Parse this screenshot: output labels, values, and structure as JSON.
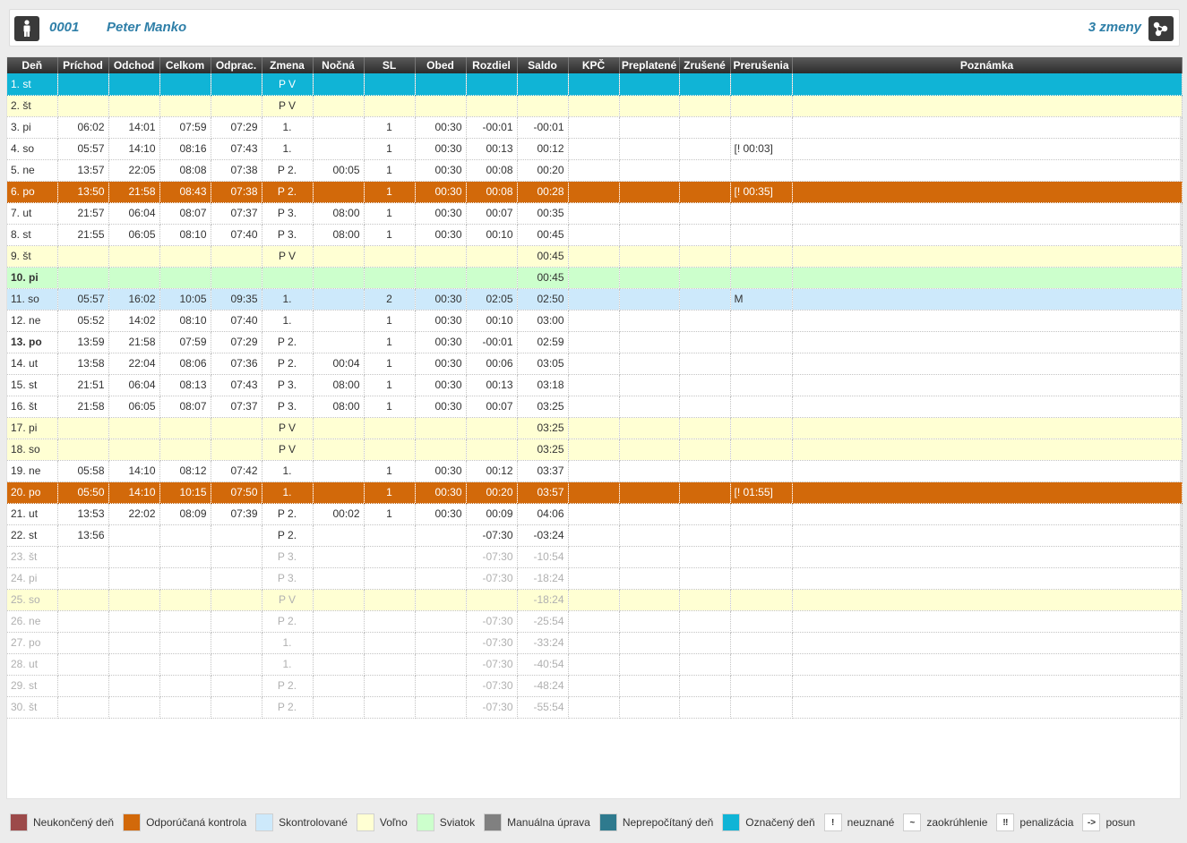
{
  "header": {
    "employee_id": "0001",
    "employee_name": "Peter Manko",
    "shifts_label": "3 zmeny",
    "person_icon": "person-icon",
    "shift_icon": "share-icon"
  },
  "columns": [
    "Deň",
    "Príchod",
    "Odchod",
    "Celkom",
    "Odprac.",
    "Zmena",
    "Nočná",
    "SL",
    "Obed",
    "Rozdiel",
    "Saldo",
    "KPČ",
    "Preplatené",
    "Zrušené",
    "Prerušenia",
    "Poznámka"
  ],
  "rows": [
    {
      "t": "oznaceny",
      "bold": false,
      "c": [
        "1. st",
        "",
        "",
        "",
        "",
        "P V",
        "",
        "",
        "",
        "",
        "",
        "",
        "",
        "",
        "",
        ""
      ]
    },
    {
      "t": "volno",
      "bold": false,
      "c": [
        "2. št",
        "",
        "",
        "",
        "",
        "P V",
        "",
        "",
        "",
        "",
        "",
        "",
        "",
        "",
        "",
        ""
      ]
    },
    {
      "t": "",
      "bold": false,
      "c": [
        "3. pi",
        "06:02",
        "14:01",
        "07:59",
        "07:29",
        "1.",
        "",
        "1",
        "00:30",
        "-00:01",
        "-00:01",
        "",
        "",
        "",
        "",
        ""
      ]
    },
    {
      "t": "",
      "bold": false,
      "c": [
        "4. so",
        "05:57",
        "14:10",
        "08:16",
        "07:43",
        "1.",
        "",
        "1",
        "00:30",
        "00:13",
        "00:12",
        "",
        "",
        "",
        "[! 00:03]",
        ""
      ]
    },
    {
      "t": "",
      "bold": false,
      "c": [
        "5. ne",
        "13:57",
        "22:05",
        "08:08",
        "07:38",
        "P 2.",
        "00:05",
        "1",
        "00:30",
        "00:08",
        "00:20",
        "",
        "",
        "",
        "",
        ""
      ]
    },
    {
      "t": "kontrola",
      "bold": false,
      "c": [
        "6. po",
        "13:50",
        "21:58",
        "08:43",
        "07:38",
        "P 2.",
        "",
        "1",
        "00:30",
        "00:08",
        "00:28",
        "",
        "",
        "",
        "[! 00:35]",
        ""
      ]
    },
    {
      "t": "",
      "bold": false,
      "c": [
        "7. ut",
        "21:57",
        "06:04",
        "08:07",
        "07:37",
        "P 3.",
        "08:00",
        "1",
        "00:30",
        "00:07",
        "00:35",
        "",
        "",
        "",
        "",
        ""
      ]
    },
    {
      "t": "",
      "bold": false,
      "c": [
        "8. st",
        "21:55",
        "06:05",
        "08:10",
        "07:40",
        "P 3.",
        "08:00",
        "1",
        "00:30",
        "00:10",
        "00:45",
        "",
        "",
        "",
        "",
        ""
      ]
    },
    {
      "t": "volno",
      "bold": false,
      "c": [
        "9. št",
        "",
        "",
        "",
        "",
        "P V",
        "",
        "",
        "",
        "",
        "00:45",
        "",
        "",
        "",
        "",
        ""
      ]
    },
    {
      "t": "sviatok",
      "bold": true,
      "c": [
        "10. pi",
        "",
        "",
        "",
        "",
        "",
        "",
        "",
        "",
        "",
        "00:45",
        "",
        "",
        "",
        "",
        ""
      ]
    },
    {
      "t": "skontrolovane",
      "bold": false,
      "c": [
        "11. so",
        "05:57",
        "16:02",
        "10:05",
        "09:35",
        "1.",
        "",
        "2",
        "00:30",
        "02:05",
        "02:50",
        "",
        "",
        "",
        "M",
        ""
      ]
    },
    {
      "t": "",
      "bold": false,
      "c": [
        "12. ne",
        "05:52",
        "14:02",
        "08:10",
        "07:40",
        "1.",
        "",
        "1",
        "00:30",
        "00:10",
        "03:00",
        "",
        "",
        "",
        "",
        ""
      ]
    },
    {
      "t": "",
      "bold": true,
      "c": [
        "13. po",
        "13:59",
        "21:58",
        "07:59",
        "07:29",
        "P 2.",
        "",
        "1",
        "00:30",
        "-00:01",
        "02:59",
        "",
        "",
        "",
        "",
        ""
      ]
    },
    {
      "t": "",
      "bold": false,
      "c": [
        "14. ut",
        "13:58",
        "22:04",
        "08:06",
        "07:36",
        "P 2.",
        "00:04",
        "1",
        "00:30",
        "00:06",
        "03:05",
        "",
        "",
        "",
        "",
        ""
      ]
    },
    {
      "t": "",
      "bold": false,
      "c": [
        "15. st",
        "21:51",
        "06:04",
        "08:13",
        "07:43",
        "P 3.",
        "08:00",
        "1",
        "00:30",
        "00:13",
        "03:18",
        "",
        "",
        "",
        "",
        ""
      ]
    },
    {
      "t": "",
      "bold": false,
      "c": [
        "16. št",
        "21:58",
        "06:05",
        "08:07",
        "07:37",
        "P 3.",
        "08:00",
        "1",
        "00:30",
        "00:07",
        "03:25",
        "",
        "",
        "",
        "",
        ""
      ]
    },
    {
      "t": "volno",
      "bold": false,
      "c": [
        "17. pi",
        "",
        "",
        "",
        "",
        "P V",
        "",
        "",
        "",
        "",
        "03:25",
        "",
        "",
        "",
        "",
        ""
      ]
    },
    {
      "t": "volno",
      "bold": false,
      "c": [
        "18. so",
        "",
        "",
        "",
        "",
        "P V",
        "",
        "",
        "",
        "",
        "03:25",
        "",
        "",
        "",
        "",
        ""
      ]
    },
    {
      "t": "",
      "bold": false,
      "c": [
        "19. ne",
        "05:58",
        "14:10",
        "08:12",
        "07:42",
        "1.",
        "",
        "1",
        "00:30",
        "00:12",
        "03:37",
        "",
        "",
        "",
        "",
        ""
      ]
    },
    {
      "t": "kontrola",
      "bold": false,
      "c": [
        "20. po",
        "05:50",
        "14:10",
        "10:15",
        "07:50",
        "1.",
        "",
        "1",
        "00:30",
        "00:20",
        "03:57",
        "",
        "",
        "",
        "[! 01:55]",
        ""
      ]
    },
    {
      "t": "",
      "bold": false,
      "c": [
        "21. ut",
        "13:53",
        "22:02",
        "08:09",
        "07:39",
        "P 2.",
        "00:02",
        "1",
        "00:30",
        "00:09",
        "04:06",
        "",
        "",
        "",
        "",
        ""
      ]
    },
    {
      "t": "",
      "bold": false,
      "c": [
        "22. st",
        "13:56",
        "",
        "",
        "",
        "P 2.",
        "",
        "",
        "",
        "-07:30",
        "-03:24",
        "",
        "",
        "",
        "",
        ""
      ]
    },
    {
      "t": "future",
      "bold": false,
      "c": [
        "23. št",
        "",
        "",
        "",
        "",
        "P 3.",
        "",
        "",
        "",
        "-07:30",
        "-10:54",
        "",
        "",
        "",
        "",
        ""
      ]
    },
    {
      "t": "future",
      "bold": false,
      "c": [
        "24. pi",
        "",
        "",
        "",
        "",
        "P 3.",
        "",
        "",
        "",
        "-07:30",
        "-18:24",
        "",
        "",
        "",
        "",
        ""
      ]
    },
    {
      "t": "volno future",
      "bold": false,
      "c": [
        "25. so",
        "",
        "",
        "",
        "",
        "P V",
        "",
        "",
        "",
        "",
        "-18:24",
        "",
        "",
        "",
        "",
        ""
      ]
    },
    {
      "t": "future",
      "bold": false,
      "c": [
        "26. ne",
        "",
        "",
        "",
        "",
        "P 2.",
        "",
        "",
        "",
        "-07:30",
        "-25:54",
        "",
        "",
        "",
        "",
        ""
      ]
    },
    {
      "t": "future",
      "bold": false,
      "c": [
        "27. po",
        "",
        "",
        "",
        "",
        "1.",
        "",
        "",
        "",
        "-07:30",
        "-33:24",
        "",
        "",
        "",
        "",
        ""
      ]
    },
    {
      "t": "future",
      "bold": false,
      "c": [
        "28. ut",
        "",
        "",
        "",
        "",
        "1.",
        "",
        "",
        "",
        "-07:30",
        "-40:54",
        "",
        "",
        "",
        "",
        ""
      ]
    },
    {
      "t": "future",
      "bold": false,
      "c": [
        "29. st",
        "",
        "",
        "",
        "",
        "P 2.",
        "",
        "",
        "",
        "-07:30",
        "-48:24",
        "",
        "",
        "",
        "",
        ""
      ]
    },
    {
      "t": "future",
      "bold": false,
      "c": [
        "30. št",
        "",
        "",
        "",
        "",
        "P 2.",
        "",
        "",
        "",
        "-07:30",
        "-55:54",
        "",
        "",
        "",
        "",
        ""
      ]
    }
  ],
  "legend": [
    {
      "type": "swatch",
      "color": "#9c4a4a",
      "label": "Neukončený deň"
    },
    {
      "type": "swatch",
      "color": "#d2690a",
      "label": "Odporúčaná kontrola"
    },
    {
      "type": "swatch",
      "color": "#cde9fb",
      "label": "Skontrolované"
    },
    {
      "type": "swatch",
      "color": "#ffffd3",
      "label": "Voľno"
    },
    {
      "type": "swatch",
      "color": "#ccffcc",
      "label": "Sviatok"
    },
    {
      "type": "swatch",
      "color": "#808080",
      "label": "Manuálna úprava"
    },
    {
      "type": "swatch",
      "color": "#2e7a8e",
      "label": "Neprepočítaný deň"
    },
    {
      "type": "swatch",
      "color": "#10b4d6",
      "label": "Označený deň"
    },
    {
      "type": "symbol",
      "symbol": "!",
      "label": "neuznané"
    },
    {
      "type": "symbol",
      "symbol": "~",
      "label": "zaokrúhlenie"
    },
    {
      "type": "symbol",
      "symbol": "‼",
      "label": "penalizácia"
    },
    {
      "type": "symbol",
      "symbol": "->",
      "label": "posun"
    }
  ]
}
